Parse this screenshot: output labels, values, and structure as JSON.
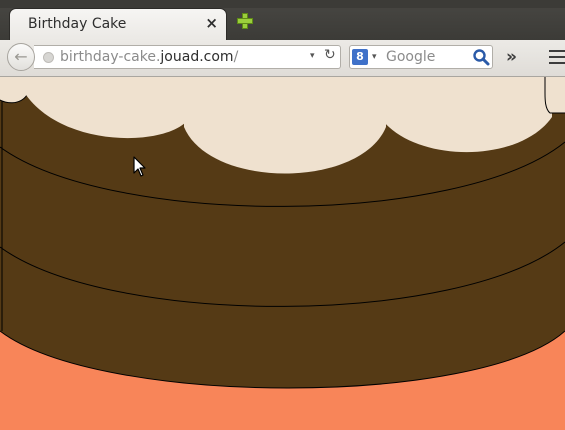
{
  "window": {
    "tab_title": "Birthday Cake",
    "tab_close": "×",
    "new_tab": "+"
  },
  "toolbar": {
    "back_icon": "←",
    "url": {
      "subdomain": "birthday-cake.",
      "domain": "jouad.com",
      "path": "/"
    },
    "url_dropdown": "▾",
    "reload_icon": "↻",
    "search": {
      "engine": "8",
      "engine_dropdown": "▾",
      "placeholder": "Google"
    },
    "overflow_icon": "»"
  },
  "colors": {
    "chocolate": "#553a15",
    "frosting": "#efe1cf",
    "page_background": "#f88559",
    "outline": "#000000"
  }
}
